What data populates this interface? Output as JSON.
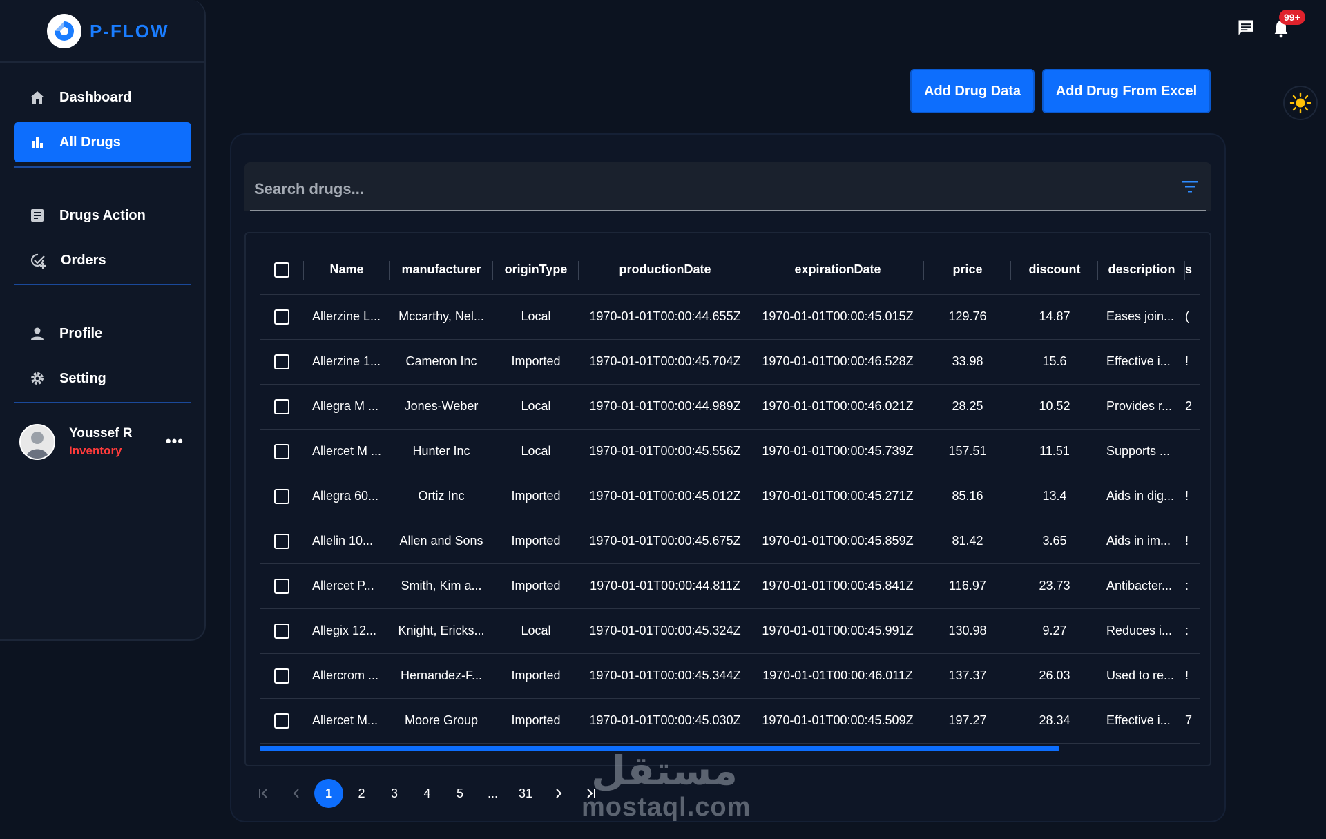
{
  "app": {
    "name": "P-FLOW"
  },
  "sidebar": {
    "items": [
      {
        "label": "Dashboard",
        "icon": "home-icon"
      },
      {
        "label": "All Drugs",
        "icon": "bar-chart-icon",
        "active": true
      },
      {
        "label": "Drugs Action",
        "icon": "document-icon"
      },
      {
        "label": "Orders",
        "icon": "check-circle-add-icon"
      },
      {
        "label": "Profile",
        "icon": "person-icon"
      },
      {
        "label": "Setting",
        "icon": "gear-icon"
      }
    ],
    "user": {
      "name": "Youssef R",
      "role": "Inventory",
      "more": "•••"
    }
  },
  "header": {
    "notifications_badge": "99+"
  },
  "actions": {
    "add_drug_data": "Add Drug Data",
    "add_drug_excel": "Add Drug From Excel"
  },
  "search": {
    "placeholder": "Search drugs..."
  },
  "table": {
    "columns": [
      "Name",
      "manufacturer",
      "originType",
      "productionDate",
      "expirationDate",
      "price",
      "discount",
      "description",
      "s"
    ],
    "rows": [
      [
        "Allerzine L...",
        "Mccarthy, Nel...",
        "Local",
        "1970-01-01T00:00:44.655Z",
        "1970-01-01T00:00:45.015Z",
        "129.76",
        "14.87",
        "Eases join...",
        "("
      ],
      [
        "Allerzine 1...",
        "Cameron Inc",
        "Imported",
        "1970-01-01T00:00:45.704Z",
        "1970-01-01T00:00:46.528Z",
        "33.98",
        "15.6",
        "Effective i...",
        "!"
      ],
      [
        "Allegra M ...",
        "Jones-Weber",
        "Local",
        "1970-01-01T00:00:44.989Z",
        "1970-01-01T00:00:46.021Z",
        "28.25",
        "10.52",
        "Provides r...",
        "2"
      ],
      [
        "Allercet M ...",
        "Hunter Inc",
        "Local",
        "1970-01-01T00:00:45.556Z",
        "1970-01-01T00:00:45.739Z",
        "157.51",
        "11.51",
        "Supports ...",
        ""
      ],
      [
        "Allegra 60...",
        "Ortiz Inc",
        "Imported",
        "1970-01-01T00:00:45.012Z",
        "1970-01-01T00:00:45.271Z",
        "85.16",
        "13.4",
        "Aids in dig...",
        "!"
      ],
      [
        "Allelin 10...",
        "Allen and Sons",
        "Imported",
        "1970-01-01T00:00:45.675Z",
        "1970-01-01T00:00:45.859Z",
        "81.42",
        "3.65",
        "Aids in im...",
        "!"
      ],
      [
        "Allercet P...",
        "Smith, Kim a...",
        "Imported",
        "1970-01-01T00:00:44.811Z",
        "1970-01-01T00:00:45.841Z",
        "116.97",
        "23.73",
        "Antibacter...",
        ":"
      ],
      [
        "Allegix 12...",
        "Knight, Ericks...",
        "Local",
        "1970-01-01T00:00:45.324Z",
        "1970-01-01T00:00:45.991Z",
        "130.98",
        "9.27",
        "Reduces i...",
        ":"
      ],
      [
        "Allercrom ...",
        "Hernandez-F...",
        "Imported",
        "1970-01-01T00:00:45.344Z",
        "1970-01-01T00:00:46.011Z",
        "137.37",
        "26.03",
        "Used to re...",
        "!"
      ],
      [
        "Allercet M...",
        "Moore Group",
        "Imported",
        "1970-01-01T00:00:45.030Z",
        "1970-01-01T00:00:45.509Z",
        "197.27",
        "28.34",
        "Effective i...",
        "7"
      ]
    ]
  },
  "pagination": {
    "pages": [
      "1",
      "2",
      "3",
      "4",
      "5",
      "...",
      "31"
    ],
    "current": "1"
  },
  "watermark": {
    "arabic": "مستقل",
    "latin": "mostaql.com"
  },
  "colors": {
    "accent": "#0d6efd",
    "background": "#0c1320",
    "danger": "#e0222c",
    "sun": "#ffc107"
  }
}
